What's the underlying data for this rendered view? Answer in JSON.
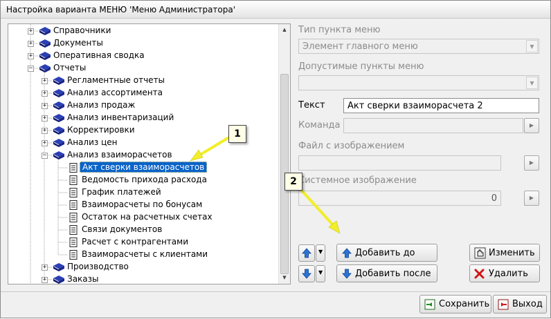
{
  "window": {
    "title": "Настройка варианта МЕНЮ 'Меню Администратора'"
  },
  "tree": {
    "items": [
      {
        "label": "Справочники",
        "kind": "book",
        "expander": "+"
      },
      {
        "label": "Документы",
        "kind": "book",
        "expander": "+"
      },
      {
        "label": "Оперативная сводка",
        "kind": "book",
        "expander": "+"
      },
      {
        "label": "Отчеты",
        "kind": "book",
        "expander": "−"
      },
      {
        "label": "Регламентные отчеты",
        "kind": "book",
        "expander": "+"
      },
      {
        "label": "Анализ ассортимента",
        "kind": "book",
        "expander": "+"
      },
      {
        "label": "Анализ продаж",
        "kind": "book",
        "expander": "+"
      },
      {
        "label": "Анализ инвентаризаций",
        "kind": "book",
        "expander": "+"
      },
      {
        "label": "Корректировки",
        "kind": "book",
        "expander": "+"
      },
      {
        "label": "Анализ цен",
        "kind": "book",
        "expander": "+"
      },
      {
        "label": "Анализ взаиморасчетов",
        "kind": "book",
        "expander": "−"
      },
      {
        "label": "Акт сверки взаиморасчетов",
        "kind": "doc",
        "selected": true
      },
      {
        "label": "Ведомость прихода расхода",
        "kind": "doc"
      },
      {
        "label": "График платежей",
        "kind": "doc"
      },
      {
        "label": "Взаиморасчеты по бонусам",
        "kind": "doc"
      },
      {
        "label": "Остаток на расчетных счетах",
        "kind": "doc"
      },
      {
        "label": "Связи документов",
        "kind": "doc"
      },
      {
        "label": "Расчет с контрагентами",
        "kind": "doc"
      },
      {
        "label": "Взаиморасчеты с клиентами",
        "kind": "doc"
      },
      {
        "label": "Производство",
        "kind": "book",
        "expander": "+"
      },
      {
        "label": "Заказы",
        "kind": "book",
        "expander": "+"
      }
    ]
  },
  "form": {
    "menu_type_label": "Тип пункта меню",
    "menu_type_value": "Элемент главного меню",
    "allowed_items_label": "Допустимые пункты меню",
    "allowed_items_value": "",
    "text_label": "Текст",
    "text_value": "Акт сверки взаиморасчета 2",
    "command_label": "Команда",
    "command_value": "",
    "image_file_label": "Файл с изображением",
    "image_file_value": "",
    "system_image_label": "Системное изображение",
    "system_image_value": "0"
  },
  "buttons": {
    "add_before": "Добавить до",
    "add_after": "Добавить после",
    "edit": "Изменить",
    "delete": "Удалить",
    "save": "Сохранить",
    "exit": "Выход"
  },
  "callouts": {
    "one": "1",
    "two": "2"
  },
  "colors": {
    "selection": "#0a63c9",
    "callout_arrow": "#f2ee2a",
    "book_blue": "#1b2a8c"
  }
}
